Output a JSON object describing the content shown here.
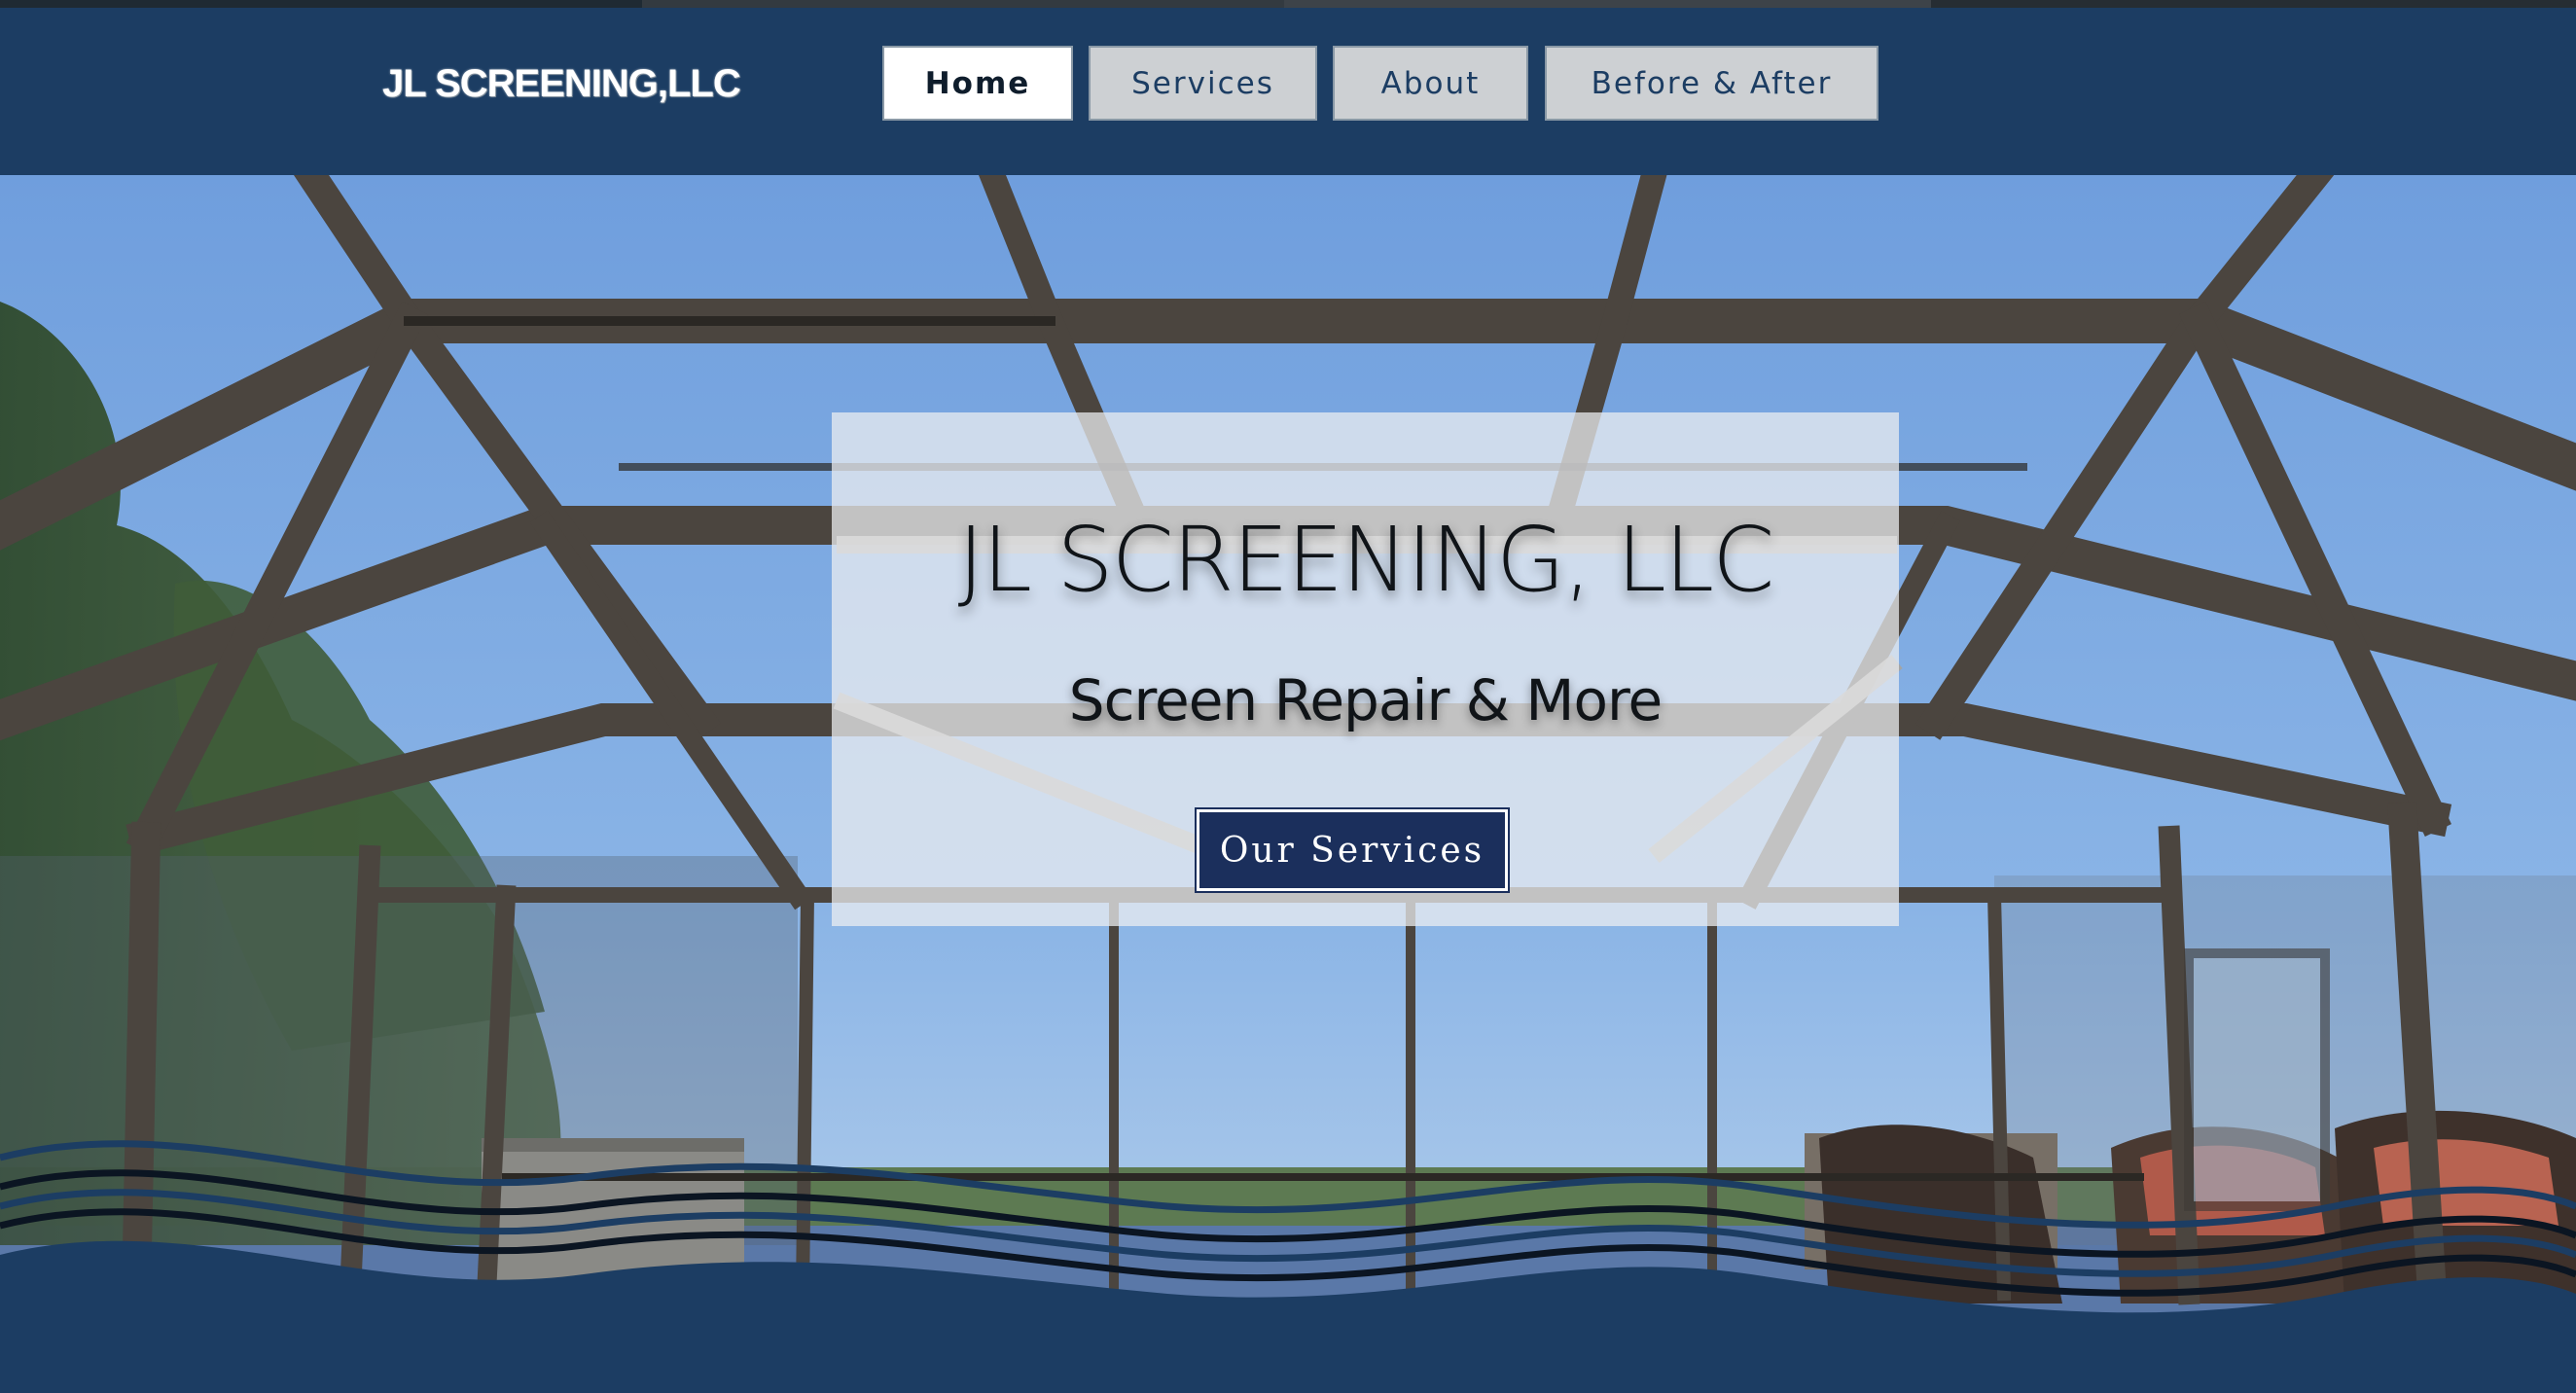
{
  "site": {
    "logo_text": "JL SCREENING,LLC"
  },
  "nav": {
    "items": [
      {
        "label": "Home",
        "active": true
      },
      {
        "label": "Services",
        "active": false
      },
      {
        "label": "About",
        "active": false
      },
      {
        "label": "Before & After",
        "active": false
      }
    ]
  },
  "hero": {
    "title": "JL SCREENING, LLC",
    "subtitle": "Screen Repair & More",
    "cta_label": "Our Services"
  },
  "colors": {
    "brand_navy": "#1c3d63",
    "button_navy": "#1b2f5c",
    "nav_inactive_bg": "#cdd0d3",
    "nav_active_bg": "#ffffff",
    "sky": "#7fa9e0"
  },
  "icons": [
    "pool-enclosure-photo",
    "wave-decoration"
  ]
}
